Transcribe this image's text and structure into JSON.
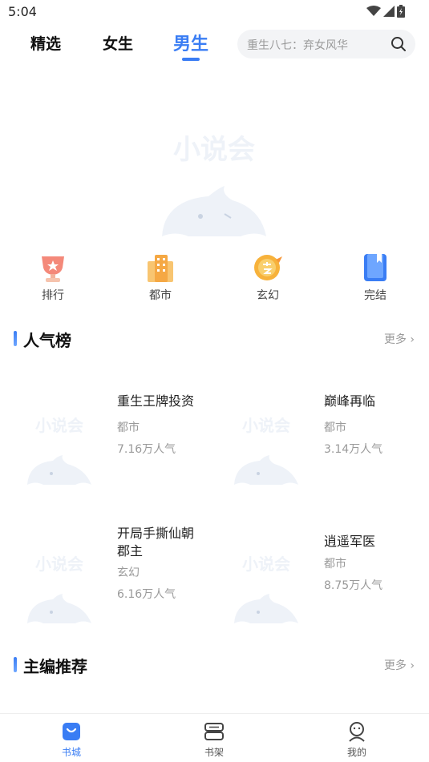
{
  "status_bar": {
    "time": "5:04"
  },
  "top_tabs": [
    {
      "label": "精选"
    },
    {
      "label": "女生"
    },
    {
      "label": "男生"
    }
  ],
  "search": {
    "placeholder": "重生八七：弃女风华"
  },
  "placeholder_logo_text": "小说会",
  "categories": [
    {
      "label": "排行",
      "icon": "trophy-icon"
    },
    {
      "label": "都市",
      "icon": "city-icon"
    },
    {
      "label": "玄幻",
      "icon": "fantasy-icon"
    },
    {
      "label": "完结",
      "icon": "book-complete-icon"
    }
  ],
  "sections": {
    "popular": {
      "title": "人气榜",
      "more": "更多 ›"
    },
    "editor": {
      "title": "主编推荐",
      "more": "更多 ›"
    }
  },
  "books": [
    {
      "title": "重生王牌投资",
      "genre": "都市",
      "popularity": "7.16万人气"
    },
    {
      "title": "巅峰再临",
      "genre": "都市",
      "popularity": "3.14万人气"
    },
    {
      "title": "开局手撕仙朝郡主",
      "genre": "玄幻",
      "popularity": "6.16万人气"
    },
    {
      "title": "逍遥军医",
      "genre": "都市",
      "popularity": "8.75万人气"
    }
  ],
  "bottom_nav": [
    {
      "label": "书城",
      "icon": "bookstore-icon"
    },
    {
      "label": "书架",
      "icon": "bookshelf-icon"
    },
    {
      "label": "我的",
      "icon": "profile-icon"
    }
  ],
  "colors": {
    "accent": "#3a7df4",
    "muted": "#9a9a9a",
    "placeholder_art": "#eef2f8"
  }
}
